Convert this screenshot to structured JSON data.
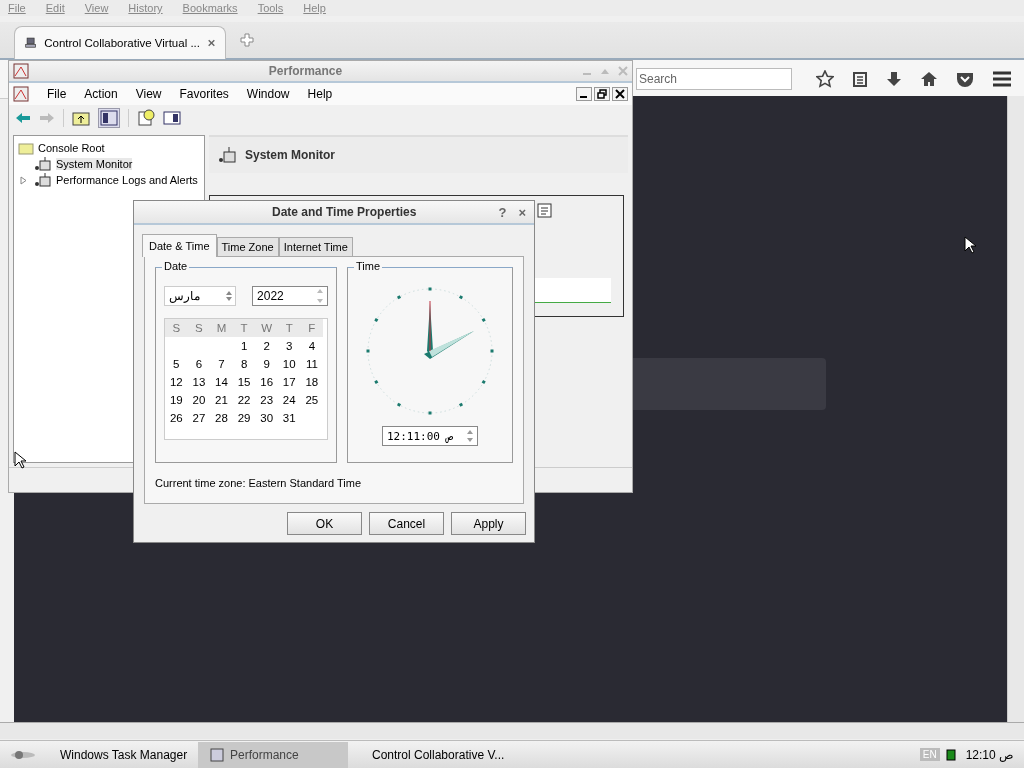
{
  "browser": {
    "menu": [
      "File",
      "Edit",
      "View",
      "History",
      "Bookmarks",
      "Tools",
      "Help"
    ],
    "tabs": [
      {
        "title": "Control Collaborative Virtual ...",
        "selected": true
      }
    ],
    "search": {
      "placeholder": "Search"
    }
  },
  "performance_window": {
    "title": "Performance",
    "menu": [
      "File",
      "Action",
      "View",
      "Favorites",
      "Window",
      "Help"
    ],
    "tree": [
      {
        "label": "Console Root",
        "children": [
          {
            "label": "System Monitor",
            "selected": true
          },
          {
            "label": "Performance Logs and Alerts",
            "selected": false
          }
        ]
      }
    ],
    "pane_title": "System Monitor"
  },
  "dialog": {
    "title": "Date and Time Properties",
    "help": "?",
    "close": "×",
    "tabs": [
      {
        "label": "Date & Time",
        "selected": true
      },
      {
        "label": "Time Zone",
        "selected": false
      },
      {
        "label": "Internet Time",
        "selected": false
      }
    ],
    "date_group": "Date",
    "month": "مارس",
    "year": "2022",
    "weekdays": [
      "S",
      "S",
      "M",
      "T",
      "W",
      "T",
      "F"
    ],
    "days": [
      "1",
      "2",
      "3",
      "4",
      "5",
      "6",
      "7",
      "8",
      "9",
      "10",
      "11",
      "12",
      "13",
      "14",
      "15",
      "16",
      "17",
      "18",
      "19",
      "20",
      "21",
      "22",
      "23",
      "24",
      "25",
      "26",
      "27",
      "28",
      "29",
      "30",
      "31"
    ],
    "time_group": "Time",
    "time": "12:11:00 ص",
    "timezone": "Current time zone:  Eastern Standard Time",
    "buttons": [
      "OK",
      "Cancel",
      "Apply"
    ]
  },
  "taskbar": {
    "items": [
      {
        "label": "Windows Task Manager",
        "selected": false
      },
      {
        "label": "Performance",
        "selected": true
      },
      {
        "label": "Control Collaborative V...",
        "selected": false
      }
    ],
    "language": "EN",
    "clock": "12:10 ص"
  }
}
